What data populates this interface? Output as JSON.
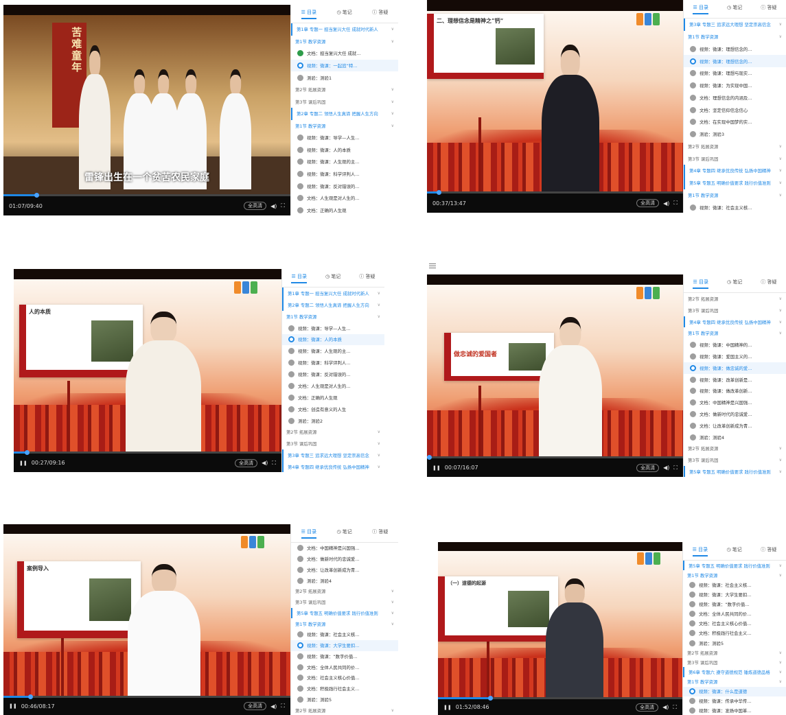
{
  "panels": [
    {
      "time": "01:07/09:40",
      "progress": 0.116,
      "scene": "gallery",
      "subtitle": "雷锋出生在一个贫苦农民家庭",
      "banner": "苦难童年",
      "quality": "全高清",
      "tabs": [
        "目录",
        "笔记",
        "答疑"
      ],
      "rows": [
        {
          "t": "chap",
          "label": "第1章 专题一 担当复兴大任 成就时代新人"
        },
        {
          "t": "secb",
          "label": "第1节 教学资源"
        },
        {
          "t": "item",
          "s": "done",
          "label": "文档：担当复兴大任 成就…"
        },
        {
          "t": "item",
          "s": "cur",
          "label": "视频：微课：一起追“特…"
        },
        {
          "t": "item",
          "label": "测验：测验1"
        },
        {
          "t": "sec",
          "label": "第2节 拓展资源"
        },
        {
          "t": "sec",
          "label": "第3节 课后巩固"
        },
        {
          "t": "chap",
          "label": "第2章 专题二 领悟人生真谛 把握人生方向"
        },
        {
          "t": "secb",
          "label": "第1节 教学资源"
        },
        {
          "t": "item",
          "label": "视频：微课：导学—人生…"
        },
        {
          "t": "item",
          "label": "视频：微课：人的本质"
        },
        {
          "t": "item",
          "label": "视频：微课：人生观的主…"
        },
        {
          "t": "item",
          "label": "视频：微课：科学评判人…"
        },
        {
          "t": "item",
          "label": "视频：微课：反对错误的…"
        },
        {
          "t": "item",
          "label": "文档：人生观是对人生的…"
        },
        {
          "t": "item",
          "label": "文档：正确的人生观"
        }
      ]
    },
    {
      "time": "00:37/13:47",
      "progress": 0.045,
      "scene": "studio",
      "slideTitle": "二、理想信念是精神之“钙”",
      "quality": "全高清",
      "tabs": [
        "目录",
        "笔记",
        "答疑"
      ],
      "rows": [
        {
          "t": "chap",
          "label": "第3章 专题三 追求远大理想 坚定崇高信念"
        },
        {
          "t": "secb",
          "label": "第1节 教学资源"
        },
        {
          "t": "item",
          "label": "视频：微课：理想信念的…"
        },
        {
          "t": "item",
          "s": "cur",
          "label": "视频：微课：理想信念的…"
        },
        {
          "t": "item",
          "label": "视频：微课：理想与现实…"
        },
        {
          "t": "item",
          "label": "视频：微课：为实现中国…"
        },
        {
          "t": "item",
          "label": "文档：理想信念的内涵及…"
        },
        {
          "t": "item",
          "label": "文档：坚定信仰信念信心"
        },
        {
          "t": "item",
          "label": "文档：在实现中国梦的实…"
        },
        {
          "t": "item",
          "label": "测验：测验3"
        },
        {
          "t": "sec",
          "label": "第2节 拓展资源"
        },
        {
          "t": "sec",
          "label": "第3节 课后巩固"
        },
        {
          "t": "chap",
          "label": "第4章 专题四 继承优良传统 弘扬中国精神"
        },
        {
          "t": "chap",
          "label": "第5章 专题五 明确价值要求 践行价值准则"
        },
        {
          "t": "secb",
          "label": "第1节 教学资源"
        },
        {
          "t": "item",
          "label": "视频：微课：社会主义核…"
        }
      ]
    },
    {
      "time": "00:27/09:16",
      "progress": 0.049,
      "scene": "studio",
      "slideTitle": "人的本质",
      "quality": "全高清",
      "tabs": [
        "目录",
        "笔记",
        "答疑"
      ],
      "rows": [
        {
          "t": "chap",
          "label": "第1章 专题一 担当复兴大任 成就时代新人"
        },
        {
          "t": "chap",
          "label": "第2章 专题二 领悟人生真谛 把握人生方向"
        },
        {
          "t": "secb",
          "label": "第1节 教学资源"
        },
        {
          "t": "item",
          "label": "视频：微课：导学—人生…"
        },
        {
          "t": "item",
          "s": "cur",
          "label": "视频：微课：人的本质"
        },
        {
          "t": "item",
          "label": "视频：微课：人生观的主…"
        },
        {
          "t": "item",
          "label": "视频：微课：科学评判人…"
        },
        {
          "t": "item",
          "label": "视频：微课：反对错误的…"
        },
        {
          "t": "item",
          "label": "文档：人生观是对人生的…"
        },
        {
          "t": "item",
          "label": "文档：正确的人生观"
        },
        {
          "t": "item",
          "label": "文档：创造有意义的人生"
        },
        {
          "t": "item",
          "label": "测验：测验2"
        },
        {
          "t": "sec",
          "label": "第2节 拓展资源"
        },
        {
          "t": "sec",
          "label": "第3节 课后巩固"
        },
        {
          "t": "chap",
          "label": "第3章 专题三 追求远大理想 坚定崇高信念"
        },
        {
          "t": "chap",
          "label": "第4章 专题四 继承优良传统 弘扬中国精神"
        }
      ]
    },
    {
      "time": "00:07/16:07",
      "progress": 0.007,
      "scene": "studio",
      "slideTitle": "做忠诚的爱国者",
      "quality": "全高清",
      "tabs": [
        "目录",
        "笔记",
        "答疑"
      ],
      "rows": [
        {
          "t": "sec",
          "label": "第2节 拓展资源"
        },
        {
          "t": "sec",
          "label": "第3节 课后巩固"
        },
        {
          "t": "chap",
          "label": "第4章 专题四 继承优良传统 弘扬中国精神"
        },
        {
          "t": "secb",
          "label": "第1节 教学资源"
        },
        {
          "t": "item",
          "label": "视频：微课：中国精神的…"
        },
        {
          "t": "item",
          "label": "视频：微课：爱国主义的…"
        },
        {
          "t": "item",
          "s": "cur",
          "label": "视频：微课：做忠诚的爱…"
        },
        {
          "t": "item",
          "label": "视频：微课：改革创新是…"
        },
        {
          "t": "item",
          "label": "视频：微课：做改革创新…"
        },
        {
          "t": "item",
          "label": "文档：中国精神是兴国强…"
        },
        {
          "t": "item",
          "label": "文档：做新时代的忠诚爱…"
        },
        {
          "t": "item",
          "label": "文档：让改革创新成为青…"
        },
        {
          "t": "item",
          "label": "测验：测验4"
        },
        {
          "t": "sec",
          "label": "第2节 拓展资源"
        },
        {
          "t": "sec",
          "label": "第3节 课后巩固"
        },
        {
          "t": "chap",
          "label": "第5章 专题五 明确价值要求 践行价值准则"
        }
      ]
    },
    {
      "time": "00:46/08:17",
      "progress": 0.093,
      "scene": "studio",
      "slideTitle": "案例导入",
      "quality": "全高清",
      "tabs": [
        "目录",
        "笔记",
        "答疑"
      ],
      "rows": [
        {
          "t": "item",
          "label": "文档：中国精神是兴国强…"
        },
        {
          "t": "item",
          "label": "文档：做新时代的忠诚爱…"
        },
        {
          "t": "item",
          "label": "文档：让改革创新成为青…"
        },
        {
          "t": "item",
          "label": "测验：测验4"
        },
        {
          "t": "sec",
          "label": "第2节 拓展资源"
        },
        {
          "t": "sec",
          "label": "第3节 课后巩固"
        },
        {
          "t": "chap",
          "label": "第5章 专题五 明确价值要求 践行价值准则"
        },
        {
          "t": "secb",
          "label": "第1节 教学资源"
        },
        {
          "t": "item",
          "label": "视频：微课：社会主义核…"
        },
        {
          "t": "item",
          "s": "cur",
          "label": "视频：微课：大学生要扣…"
        },
        {
          "t": "item",
          "label": "视频：微课：“数字价值…"
        },
        {
          "t": "item",
          "label": "文档：全体人民共同的价…"
        },
        {
          "t": "item",
          "label": "文档：社会主义核心价值…"
        },
        {
          "t": "item",
          "label": "文档：积极践行社会主义…"
        },
        {
          "t": "item",
          "label": "测验：测验5"
        },
        {
          "t": "sec",
          "label": "第2节 拓展资源"
        }
      ]
    },
    {
      "time": "01:52/08:46",
      "progress": 0.213,
      "scene": "studio",
      "slideTitle": "（一）道德的起源",
      "quality": "全高清",
      "tabs": [
        "目录",
        "笔记",
        "答疑"
      ],
      "rows": [
        {
          "t": "chap",
          "label": "第5章 专题五 明确价值要求 践行价值准则"
        },
        {
          "t": "secb",
          "label": "第1节 教学资源"
        },
        {
          "t": "item",
          "label": "视频：微课：社会主义核…"
        },
        {
          "t": "item",
          "label": "视频：微课：大学生要扣…"
        },
        {
          "t": "item",
          "label": "视频：微课：“数字价值…"
        },
        {
          "t": "item",
          "label": "文档：全体人民共同的价…"
        },
        {
          "t": "item",
          "label": "文档：社会主义核心价值…"
        },
        {
          "t": "item",
          "label": "文档：积极践行社会主义…"
        },
        {
          "t": "item",
          "label": "测验：测验5"
        },
        {
          "t": "sec",
          "label": "第2节 拓展资源"
        },
        {
          "t": "sec",
          "label": "第3节 课后巩固"
        },
        {
          "t": "chap",
          "label": "第6章 专题六 遵守道德规范 锤炼道德品格"
        },
        {
          "t": "secb",
          "label": "第1节 教学资源"
        },
        {
          "t": "item",
          "s": "cur",
          "label": "视频：微课：什么是道德"
        },
        {
          "t": "item",
          "label": "视频：微课：传承中华传…"
        },
        {
          "t": "item",
          "label": "视频：微课：发扬中国革…"
        }
      ]
    }
  ]
}
